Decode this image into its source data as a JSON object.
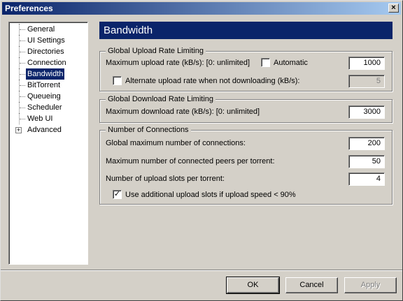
{
  "window": {
    "title": "Preferences",
    "close_glyph": "×"
  },
  "sidebar": {
    "items": [
      {
        "label": "General"
      },
      {
        "label": "UI Settings"
      },
      {
        "label": "Directories"
      },
      {
        "label": "Connection"
      },
      {
        "label": "Bandwidth"
      },
      {
        "label": "BitTorrent"
      },
      {
        "label": "Queueing"
      },
      {
        "label": "Scheduler"
      },
      {
        "label": "Web UI"
      },
      {
        "label": "Advanced"
      }
    ],
    "selected": "Bandwidth",
    "expander_glyph": "+"
  },
  "header": {
    "title": "Bandwidth"
  },
  "upload_group": {
    "title": "Global Upload Rate Limiting",
    "max_upload_label": "Maximum upload rate (kB/s): [0: unlimited]",
    "automatic_label": "Automatic",
    "automatic_checked": false,
    "max_upload_value": "1000",
    "alternate_label": "Alternate upload rate when not downloading (kB/s):",
    "alternate_checked": false,
    "alternate_value": "5"
  },
  "download_group": {
    "title": "Global Download Rate Limiting",
    "max_download_label": "Maximum download rate (kB/s): [0: unlimited]",
    "max_download_value": "3000"
  },
  "connections_group": {
    "title": "Number of Connections",
    "global_max_label": "Global maximum number of connections:",
    "global_max_value": "200",
    "peers_label": "Maximum number of connected peers per torrent:",
    "peers_value": "50",
    "slots_label": "Number of upload slots per torrent:",
    "slots_value": "4",
    "additional_slots_label": "Use additional upload slots if upload speed < 90%",
    "additional_slots_checked": true,
    "check_glyph": "✓"
  },
  "buttons": {
    "ok": "OK",
    "cancel": "Cancel",
    "apply": "Apply"
  }
}
